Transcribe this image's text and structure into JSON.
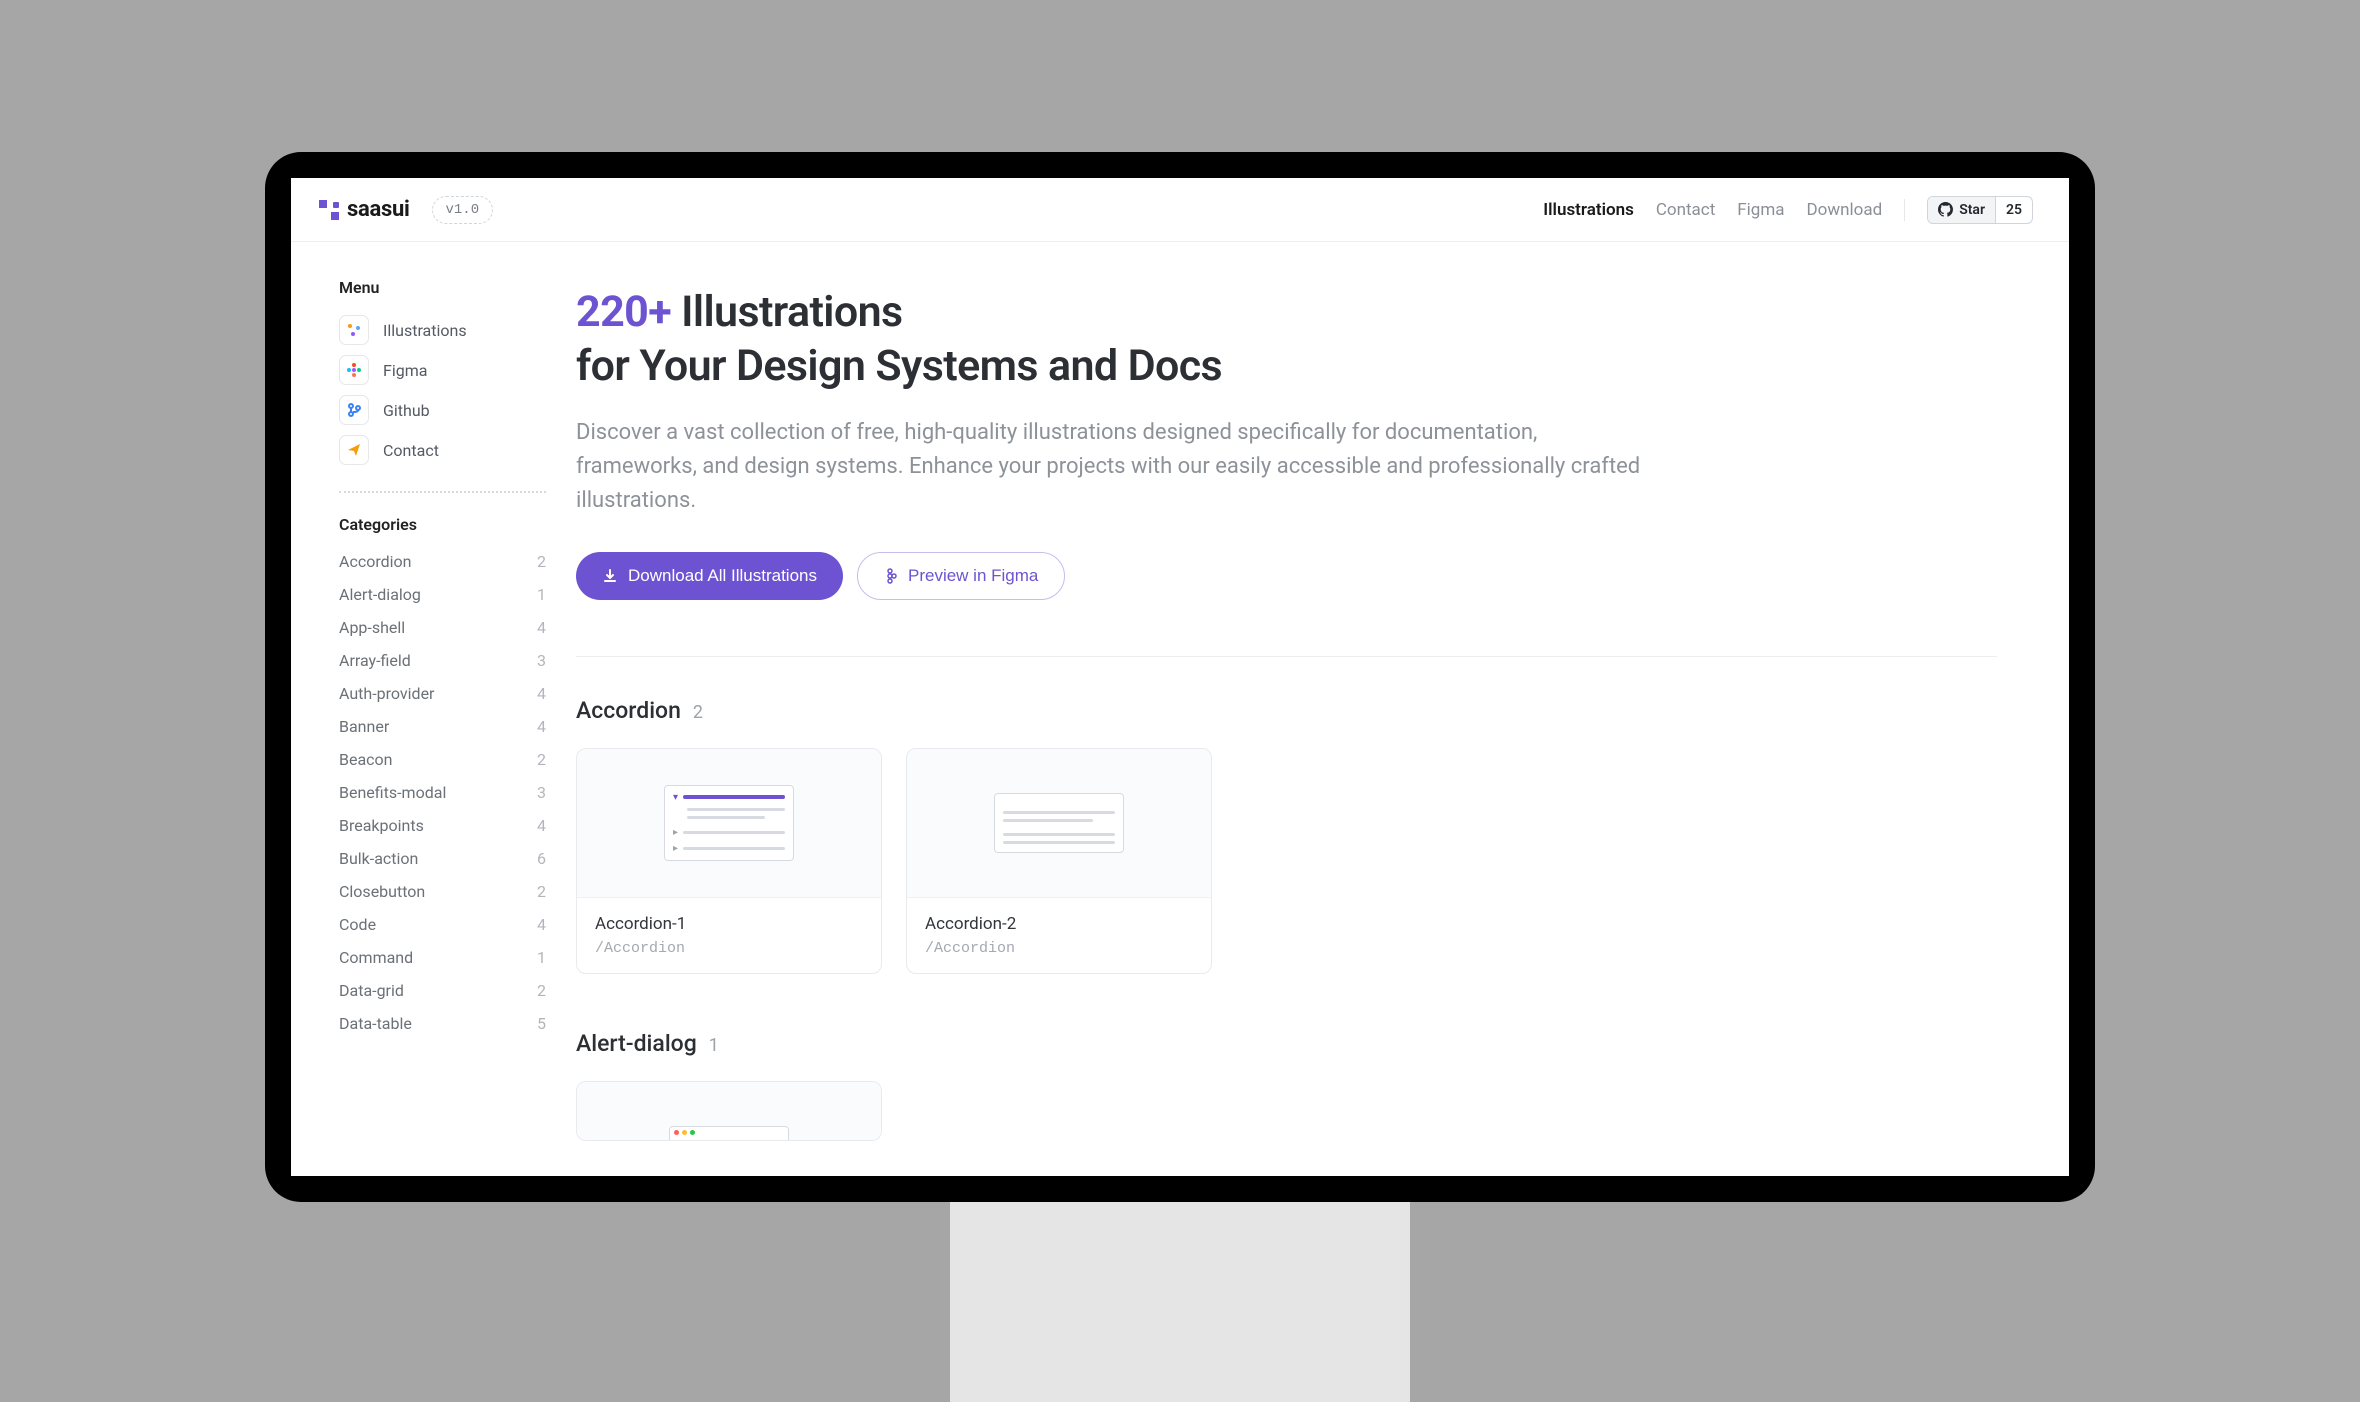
{
  "header": {
    "logo_text": "saasui",
    "version": "v1.0",
    "nav": {
      "illustrations": "Illustrations",
      "contact": "Contact",
      "figma": "Figma",
      "download": "Download"
    },
    "github": {
      "star_label": "Star",
      "count": "25"
    }
  },
  "sidebar": {
    "menu_heading": "Menu",
    "menu": [
      {
        "label": "Illustrations",
        "icon": "chart"
      },
      {
        "label": "Figma",
        "icon": "figma"
      },
      {
        "label": "Github",
        "icon": "github"
      },
      {
        "label": "Contact",
        "icon": "mail"
      }
    ],
    "categories_heading": "Categories",
    "categories": [
      {
        "label": "Accordion",
        "count": "2"
      },
      {
        "label": "Alert-dialog",
        "count": "1"
      },
      {
        "label": "App-shell",
        "count": "4"
      },
      {
        "label": "Array-field",
        "count": "3"
      },
      {
        "label": "Auth-provider",
        "count": "4"
      },
      {
        "label": "Banner",
        "count": "4"
      },
      {
        "label": "Beacon",
        "count": "2"
      },
      {
        "label": "Benefits-modal",
        "count": "3"
      },
      {
        "label": "Breakpoints",
        "count": "4"
      },
      {
        "label": "Bulk-action",
        "count": "6"
      },
      {
        "label": "Closebutton",
        "count": "2"
      },
      {
        "label": "Code",
        "count": "4"
      },
      {
        "label": "Command",
        "count": "1"
      },
      {
        "label": "Data-grid",
        "count": "2"
      },
      {
        "label": "Data-table",
        "count": "5"
      }
    ]
  },
  "hero": {
    "count": "220+",
    "title_1": "Illustrations",
    "title_2": "for Your Design Systems and Docs",
    "subtitle": "Discover a vast collection of free, high-quality illustrations designed specifically for documentation, frameworks, and design systems. Enhance your projects with our easily accessible and professionally crafted illustrations.",
    "download_btn": "Download All Illustrations",
    "preview_btn": "Preview in Figma"
  },
  "sections": {
    "accordion": {
      "title": "Accordion",
      "count": "2",
      "items": [
        {
          "name": "Accordion-1",
          "path": "/Accordion"
        },
        {
          "name": "Accordion-2",
          "path": "/Accordion"
        }
      ]
    },
    "alert_dialog": {
      "title": "Alert-dialog",
      "count": "1"
    }
  }
}
